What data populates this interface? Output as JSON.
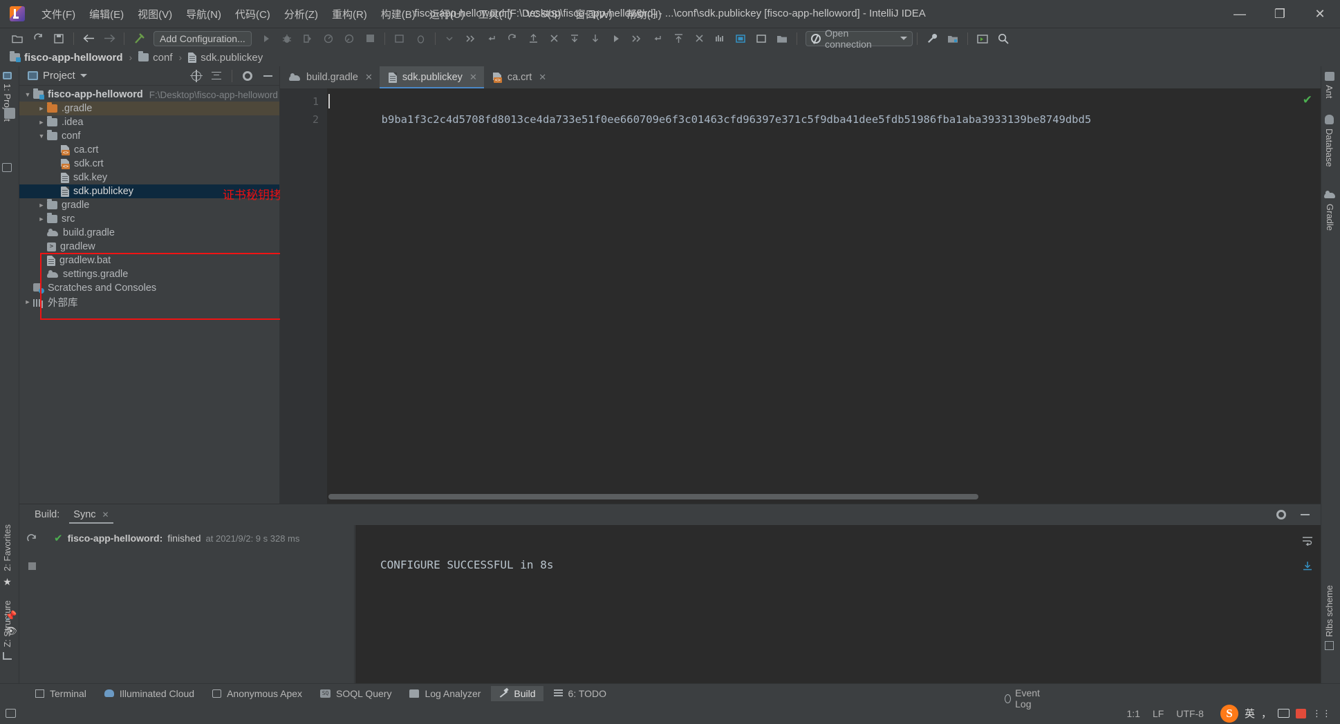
{
  "window": {
    "title": "fisco-app-helloword [F:\\Desktop\\fisco-app-helloword] - ...\\conf\\sdk.publickey [fisco-app-helloword] - IntelliJ IDEA",
    "minimize": "—",
    "maximize": "❐",
    "close": "✕"
  },
  "menu": [
    {
      "label": "文件(F)"
    },
    {
      "label": "编辑(E)"
    },
    {
      "label": "视图(V)"
    },
    {
      "label": "导航(N)"
    },
    {
      "label": "代码(C)"
    },
    {
      "label": "分析(Z)"
    },
    {
      "label": "重构(R)"
    },
    {
      "label": "构建(B)"
    },
    {
      "label": "运行(U)"
    },
    {
      "label": "工具(T)"
    },
    {
      "label": "VCS(S)"
    },
    {
      "label": "窗口(W)"
    },
    {
      "label": "帮助(H)"
    }
  ],
  "toolbar": {
    "add_configuration": "Add Configuration...",
    "open_connection": "Open connection",
    "icons": [
      "open-folder-icon",
      "sync-icon",
      "save-icon",
      "back-arrow-icon",
      "forward-arrow-icon",
      "build-hammer-icon"
    ],
    "run_icons": [
      "run-icon",
      "debug-icon",
      "run-coverage-icon",
      "profile-icon",
      "profile-alt-icon",
      "stop-icon"
    ],
    "debug_icons": [
      "attach-debug-icon",
      "debug-tools-icon",
      "step-over-icon",
      "step-into-icon",
      "force-step-into-icon",
      "step-out-icon",
      "run-to-cursor-icon",
      "evaluate-icon",
      "resume-icon",
      "mute-breakpoints-icon",
      "view-breakpoints-icon",
      "frames-icon"
    ],
    "right_icons": [
      "settings-wrench-icon",
      "project-structure-icon",
      "preview-icon",
      "search-icon"
    ]
  },
  "breadcrumb": [
    {
      "label": "fisco-app-helloword",
      "icon": "module-folder-icon"
    },
    {
      "label": "conf",
      "icon": "folder-icon"
    },
    {
      "label": "sdk.publickey",
      "icon": "file-icon"
    }
  ],
  "project_panel": {
    "title": "Project",
    "tree": [
      {
        "label": "fisco-app-helloword",
        "hint": "F:\\Desktop\\fisco-app-helloword",
        "icon": "module-folder-icon",
        "arrow": "down",
        "indent": 0,
        "state": "root"
      },
      {
        "label": ".gradle",
        "hint": "",
        "icon": "folder-orange-icon",
        "arrow": "right",
        "indent": 1,
        "state": "highlight"
      },
      {
        "label": ".idea",
        "hint": "",
        "icon": "folder-icon",
        "arrow": "right",
        "indent": 1,
        "state": ""
      },
      {
        "label": "conf",
        "hint": "",
        "icon": "folder-icon",
        "arrow": "down",
        "indent": 1,
        "state": ""
      },
      {
        "label": "ca.crt",
        "hint": "",
        "icon": "certificate-icon",
        "arrow": "none",
        "indent": 2,
        "state": ""
      },
      {
        "label": "sdk.crt",
        "hint": "",
        "icon": "certificate-icon",
        "arrow": "none",
        "indent": 2,
        "state": ""
      },
      {
        "label": "sdk.key",
        "hint": "",
        "icon": "file-icon",
        "arrow": "none",
        "indent": 2,
        "state": ""
      },
      {
        "label": "sdk.publickey",
        "hint": "",
        "icon": "file-icon",
        "arrow": "none",
        "indent": 2,
        "state": "selected"
      },
      {
        "label": "gradle",
        "hint": "",
        "icon": "folder-icon",
        "arrow": "right",
        "indent": 1,
        "state": ""
      },
      {
        "label": "src",
        "hint": "",
        "icon": "folder-icon",
        "arrow": "right",
        "indent": 1,
        "state": ""
      },
      {
        "label": "build.gradle",
        "hint": "",
        "icon": "gradle-icon",
        "arrow": "none",
        "indent": 1,
        "state": ""
      },
      {
        "label": "gradlew",
        "hint": "",
        "icon": "script-icon",
        "arrow": "none",
        "indent": 1,
        "state": ""
      },
      {
        "label": "gradlew.bat",
        "hint": "",
        "icon": "file-icon",
        "arrow": "none",
        "indent": 1,
        "state": ""
      },
      {
        "label": "settings.gradle",
        "hint": "",
        "icon": "gradle-icon",
        "arrow": "none",
        "indent": 1,
        "state": ""
      },
      {
        "label": "Scratches and Consoles",
        "hint": "",
        "icon": "scratch-icon",
        "arrow": "none",
        "indent": 0,
        "state": ""
      },
      {
        "label": "外部库",
        "hint": "",
        "icon": "library-icon",
        "arrow": "right",
        "indent": 0,
        "state": ""
      }
    ]
  },
  "annotation": {
    "text": "证书秘钥拷贝至conf下",
    "color": "#ee1111"
  },
  "editor": {
    "tabs": [
      {
        "label": "build.gradle",
        "icon": "gradle-icon",
        "active": false,
        "close": "✕"
      },
      {
        "label": "sdk.publickey",
        "icon": "file-icon",
        "active": true,
        "close": "✕"
      },
      {
        "label": "ca.crt",
        "icon": "certificate-icon",
        "active": false,
        "close": "✕"
      }
    ],
    "line_numbers": [
      "1",
      "2"
    ],
    "content": "b9ba1f3c2c4d5708fd8013ce4da733e51f0ee660709e6f3c01463cfd96397e371c5f9dba41dee5fdb51986fba1aba3933139be8749dbd5",
    "inspection_status": "✔"
  },
  "build_panel": {
    "label": "Build:",
    "tab": "Sync",
    "tab_close": "✕",
    "tree_row": {
      "check": "✔",
      "name": "fisco-app-helloword:",
      "state": "finished",
      "time": "at 2021/9/2: 9 s 328 ms"
    },
    "console_output": "CONFIGURE SUCCESSFUL in 8s",
    "header_icons": [
      "gear-icon",
      "minimize-icon"
    ],
    "rail_icons": [
      "rerun-icon",
      "stop-icon"
    ],
    "right_icons": [
      "soft-wrap-icon",
      "scroll-to-end-icon"
    ]
  },
  "bottom_tools": [
    {
      "label": "Terminal",
      "icon": "terminal-icon",
      "active": false
    },
    {
      "label": "Illuminated Cloud",
      "icon": "cloud-icon",
      "active": false
    },
    {
      "label": "Anonymous Apex",
      "icon": "apex-icon",
      "active": false
    },
    {
      "label": "SOQL Query",
      "icon": "soql-icon",
      "active": false
    },
    {
      "label": "Log Analyzer",
      "icon": "log-analyzer-icon",
      "active": false
    },
    {
      "label": "Build",
      "icon": "hammer-icon",
      "active": true
    },
    {
      "label": "6: TODO",
      "icon": "todo-icon",
      "active": false
    }
  ],
  "left_rail": [
    {
      "label": "1: Project",
      "position": "top"
    },
    {
      "label": "2: Favorites",
      "position": "bottom"
    },
    {
      "label": "Z: Structure",
      "position": "bottom"
    }
  ],
  "right_rail": [
    {
      "label": "Ant"
    },
    {
      "label": "Database"
    },
    {
      "label": "Gradle"
    },
    {
      "label": "Rlbs scheme"
    }
  ],
  "status_bar": {
    "caret_position": "1:1",
    "line_separator": "LF",
    "encoding": "UTF-8",
    "event_log": "Event Log",
    "ime": {
      "logo": "S",
      "mode": "英",
      "punctuation": "，",
      "keyboard": "⌨",
      "toolbox": "🧰",
      "menu": "⋮⋮"
    }
  }
}
